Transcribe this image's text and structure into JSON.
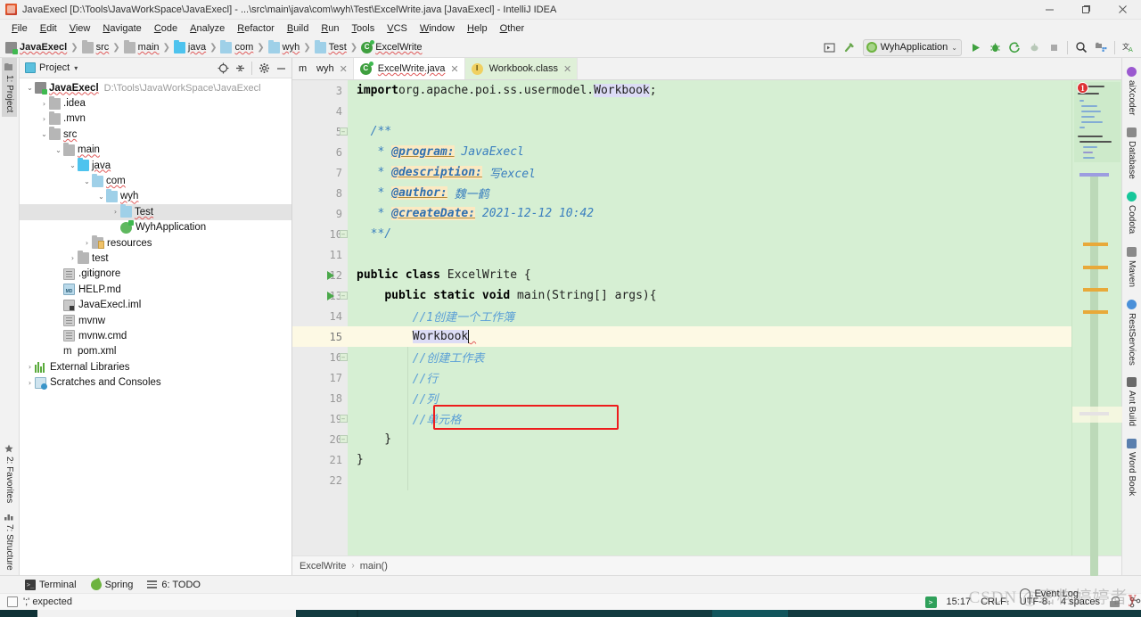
{
  "window": {
    "title": "JavaExecl [D:\\Tools\\JavaWorkSpace\\JavaExecl] - ...\\src\\main\\java\\com\\wyh\\Test\\ExcelWrite.java [JavaExecl] - IntelliJ IDEA",
    "app_icon": "intellij-idea-icon",
    "minimize": "─",
    "maximize": "❐",
    "close": "✕"
  },
  "menubar": {
    "items": [
      {
        "label": "File"
      },
      {
        "label": "Edit"
      },
      {
        "label": "View"
      },
      {
        "label": "Navigate"
      },
      {
        "label": "Code"
      },
      {
        "label": "Analyze"
      },
      {
        "label": "Refactor"
      },
      {
        "label": "Build"
      },
      {
        "label": "Run"
      },
      {
        "label": "Tools"
      },
      {
        "label": "VCS"
      },
      {
        "label": "Window"
      },
      {
        "label": "Help"
      },
      {
        "label": "Other"
      }
    ]
  },
  "navbar": {
    "breadcrumbs": [
      {
        "label": "JavaExecl",
        "icon": "project-module-icon",
        "bold": true,
        "squiggly": true
      },
      {
        "label": "src",
        "icon": "folder-icon",
        "squiggly": true
      },
      {
        "label": "main",
        "icon": "folder-icon",
        "squiggly": true
      },
      {
        "label": "java",
        "icon": "folder-source-icon",
        "squiggly": true
      },
      {
        "label": "com",
        "icon": "folder-package-icon",
        "squiggly": true
      },
      {
        "label": "wyh",
        "icon": "folder-package-icon",
        "squiggly": true
      },
      {
        "label": "Test",
        "icon": "folder-package-icon",
        "squiggly": true
      },
      {
        "label": "ExcelWrite",
        "icon": "java-class-icon",
        "squiggly": true
      }
    ],
    "run_config": {
      "name": "WyhApplication",
      "chevron": "⌄",
      "icon": "spring-boot-run-icon"
    },
    "right_icons": [
      "select-in-icon",
      "build-hammer-icon",
      "run-icon",
      "debug-icon",
      "run-coverage-icon",
      "profiler-icon",
      "stop-icon",
      "search-everywhere-icon",
      "project-structure-icon",
      "translate-icon"
    ]
  },
  "left_strip": {
    "top": [
      {
        "label": "1: Project",
        "icon": "project-folder-icon",
        "active": true
      }
    ],
    "bottom": [
      {
        "label": "2: Favorites",
        "icon": "star-icon"
      },
      {
        "label": "7: Structure",
        "icon": "structure-icon"
      }
    ]
  },
  "right_strip": {
    "items": [
      {
        "label": "aiXcoder",
        "icon": "aixcoder-icon",
        "color": "#9b59d0"
      },
      {
        "label": "Database",
        "icon": "database-icon",
        "color": "#8a8a8a"
      },
      {
        "label": "Codota",
        "icon": "codota-icon",
        "color": "#16c79a"
      },
      {
        "label": "Maven",
        "icon": "maven-icon",
        "color": "#8a8a8a"
      },
      {
        "label": "RestServices",
        "icon": "rest-services-icon",
        "color": "#4a90d9"
      },
      {
        "label": "Ant Build",
        "icon": "ant-build-icon",
        "color": "#6b6b6b"
      },
      {
        "label": "Word Book",
        "icon": "word-book-icon",
        "color": "#5a7fae"
      }
    ]
  },
  "project_panel": {
    "header": {
      "title": "Project",
      "chevron": "▾",
      "icon": "project-view-icon",
      "actions": [
        "locate-icon",
        "collapse-all-icon",
        "settings-gear-icon",
        "hide-icon"
      ]
    },
    "tree": [
      {
        "depth": 0,
        "arrow": "⌄",
        "icon": "project-module-icon",
        "label": "JavaExecl",
        "bold": true,
        "squiggly": true,
        "path": "D:\\Tools\\JavaWorkSpace\\JavaExecl"
      },
      {
        "depth": 1,
        "arrow": "›",
        "icon": "folder-icon",
        "label": ".idea"
      },
      {
        "depth": 1,
        "arrow": "›",
        "icon": "folder-icon",
        "label": ".mvn"
      },
      {
        "depth": 1,
        "arrow": "⌄",
        "icon": "folder-icon",
        "label": "src",
        "squiggly": true
      },
      {
        "depth": 2,
        "arrow": "⌄",
        "icon": "folder-icon",
        "label": "main",
        "squiggly": true
      },
      {
        "depth": 3,
        "arrow": "⌄",
        "icon": "folder-source-icon",
        "label": "java",
        "squiggly": true
      },
      {
        "depth": 4,
        "arrow": "⌄",
        "icon": "folder-package-icon",
        "label": "com",
        "squiggly": true
      },
      {
        "depth": 5,
        "arrow": "⌄",
        "icon": "folder-package-icon",
        "label": "wyh",
        "squiggly": true
      },
      {
        "depth": 6,
        "arrow": "›",
        "icon": "folder-package-icon",
        "label": "Test",
        "squiggly": true,
        "selected_grey": true
      },
      {
        "depth": 6,
        "arrow": "",
        "icon": "spring-app-class-icon",
        "label": "WyhApplication"
      },
      {
        "depth": 4,
        "arrow": "›",
        "icon": "folder-resources-icon",
        "label": "resources"
      },
      {
        "depth": 3,
        "arrow": "›",
        "icon": "folder-icon",
        "label": "test"
      },
      {
        "depth": 2,
        "arrow": "",
        "icon": "file-icon",
        "label": ".gitignore"
      },
      {
        "depth": 2,
        "arrow": "",
        "icon": "markdown-file-icon",
        "label": "HELP.md"
      },
      {
        "depth": 2,
        "arrow": "",
        "icon": "iml-file-icon",
        "label": "JavaExecl.iml"
      },
      {
        "depth": 2,
        "arrow": "",
        "icon": "file-icon",
        "label": "mvnw"
      },
      {
        "depth": 2,
        "arrow": "",
        "icon": "file-icon",
        "label": "mvnw.cmd"
      },
      {
        "depth": 2,
        "arrow": "",
        "icon": "maven-pom-icon",
        "label": "pom.xml"
      },
      {
        "depth": 0,
        "arrow": "›",
        "icon": "external-libraries-icon",
        "label": "External Libraries"
      },
      {
        "depth": 0,
        "arrow": "›",
        "icon": "scratches-icon",
        "label": "Scratches and Consoles"
      }
    ]
  },
  "editor": {
    "tabs": [
      {
        "label": "wyh",
        "icon": "maven-pom-icon",
        "active": false,
        "close": "✕",
        "style": "plain"
      },
      {
        "label": "ExcelWrite.java",
        "icon": "java-class-icon",
        "active": true,
        "close": "✕",
        "squiggly": true,
        "style": "white"
      },
      {
        "label": "Workbook.class",
        "icon": "class-file-icon",
        "active": false,
        "close": "✕",
        "style": "green"
      }
    ],
    "first_line_number": 3,
    "current_line": 15,
    "lines": [
      {
        "n": 3,
        "kind": "import",
        "text": "import org.apache.poi.ss.usermodel.Workbook;"
      },
      {
        "n": 4,
        "kind": "blank",
        "text": ""
      },
      {
        "n": 5,
        "kind": "javadoc-open",
        "text": "/**",
        "fold": true
      },
      {
        "n": 6,
        "kind": "javadoc-tag",
        "tag": "@program:",
        "value": "JavaExecl"
      },
      {
        "n": 7,
        "kind": "javadoc-tag",
        "tag": "@description:",
        "value": "写excel"
      },
      {
        "n": 8,
        "kind": "javadoc-tag",
        "tag": "@author:",
        "value": "魏一鹤"
      },
      {
        "n": 9,
        "kind": "javadoc-tag",
        "tag": "@createDate:",
        "value": "2021-12-12 10:42"
      },
      {
        "n": 10,
        "kind": "javadoc-close",
        "text": "**/",
        "fold": true
      },
      {
        "n": 11,
        "kind": "blank",
        "text": ""
      },
      {
        "n": 12,
        "kind": "code",
        "text": "public class ExcelWrite {",
        "gutter_run": true
      },
      {
        "n": 13,
        "kind": "code",
        "text": "    public static void main(String[] args){",
        "gutter_run": true,
        "fold": true
      },
      {
        "n": 14,
        "kind": "comment",
        "text": "        //1创建一个工作簿"
      },
      {
        "n": 15,
        "kind": "edit",
        "text": "        Workbook",
        "highlight_box": true,
        "caret": true
      },
      {
        "n": 16,
        "kind": "comment",
        "text": "        //创建工作表",
        "fold": true
      },
      {
        "n": 17,
        "kind": "comment",
        "text": "        //行"
      },
      {
        "n": 18,
        "kind": "comment",
        "text": "        //列"
      },
      {
        "n": 19,
        "kind": "comment",
        "text": "        //单元格",
        "fold": true
      },
      {
        "n": 20,
        "kind": "code",
        "text": "    }",
        "fold": true
      },
      {
        "n": 21,
        "kind": "code",
        "text": "}"
      },
      {
        "n": 22,
        "kind": "blank",
        "text": ""
      }
    ],
    "minimap": {
      "error_count": "1",
      "error_badge_icon": "error-marker-icon"
    },
    "breadcrumb": [
      {
        "label": "ExcelWrite"
      },
      {
        "label": "main()"
      }
    ],
    "breadcrumb_sep": "›"
  },
  "bottom_bar": {
    "items": [
      {
        "label": "Terminal",
        "icon": "terminal-icon"
      },
      {
        "label": "Spring",
        "icon": "spring-leaf-icon"
      },
      {
        "label": "6: TODO",
        "icon": "todo-list-icon"
      }
    ]
  },
  "status": {
    "message": "';' expected",
    "message_icon": "inspection-box-icon",
    "event_log": "Event Log",
    "event_log_icon": "bell-icon",
    "right": [
      {
        "label": "15:17",
        "name": "caret-position"
      },
      {
        "label": "CRLF",
        "name": "line-separator",
        "suffix": "↕"
      },
      {
        "label": "UTF-8",
        "name": "file-encoding",
        "suffix": "↕"
      },
      {
        "label": "4 spaces",
        "name": "indent"
      },
      {
        "label": "",
        "name": "lock-icon"
      },
      {
        "label": "",
        "name": "git-branch-icon"
      }
    ],
    "git_icon": "git-terminal-icon"
  },
  "watermark": {
    "text": "CSDN @密构婷婷者",
    "suffix": "y"
  },
  "colors": {
    "editor_bg": "#d6efd3",
    "current_line_bg": "#fdf9e4",
    "error_red": "#ee1c1c",
    "accent_green": "#4aa84a",
    "gutter_bg": "#ebebeb"
  }
}
